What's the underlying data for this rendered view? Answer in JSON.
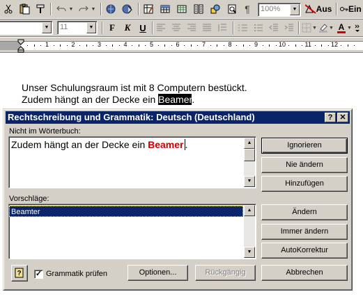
{
  "toolbar1": {
    "zoom": "100%",
    "track_changes_label": "Aus",
    "insert_label": "Ein"
  },
  "toolbar2": {
    "font_size": "11",
    "bold_label": "F",
    "italic_label": "K",
    "underline_label": "U",
    "font_color_label": "A"
  },
  "ruler": {
    "numbers": [
      "1",
      "2",
      "3",
      "4",
      "5",
      "6",
      "7",
      "8",
      "9",
      "10",
      "11",
      "12"
    ]
  },
  "document": {
    "line1": "Unser Schulungsraum ist mit 8 Computern bestückt.",
    "line2_prefix": "Zudem hängt an der Decke ein ",
    "line2_selected": "Beamer",
    "line2_suffix": "."
  },
  "dialog": {
    "title": "Rechtschreibung und Grammatik: Deutsch (Deutschland)",
    "help_btn": "?",
    "close_btn": "✕",
    "not_in_dict_label": "Nicht im Wörterbuch:",
    "sentence_prefix": "Zudem hängt an der Decke ein ",
    "sentence_error": "Beamer",
    "sentence_suffix": ".",
    "suggestions_label": "Vorschläge:",
    "suggestions": [
      "Beamter"
    ],
    "buttons": {
      "ignore": "Ignorieren",
      "never_change": "Nie ändern",
      "add": "Hinzufügen",
      "change": "Ändern",
      "always_change": "Immer ändern",
      "autocorrect": "AutoKorrektur",
      "options": "Optionen...",
      "undo": "Rückgängig",
      "cancel": "Abbrechen"
    },
    "grammar_check_label": "Grammatik prüfen",
    "grammar_check_checked": true,
    "colors": {
      "titlebar": "#0a246a",
      "selection": "#0a246a",
      "error_text": "#d00000"
    }
  }
}
